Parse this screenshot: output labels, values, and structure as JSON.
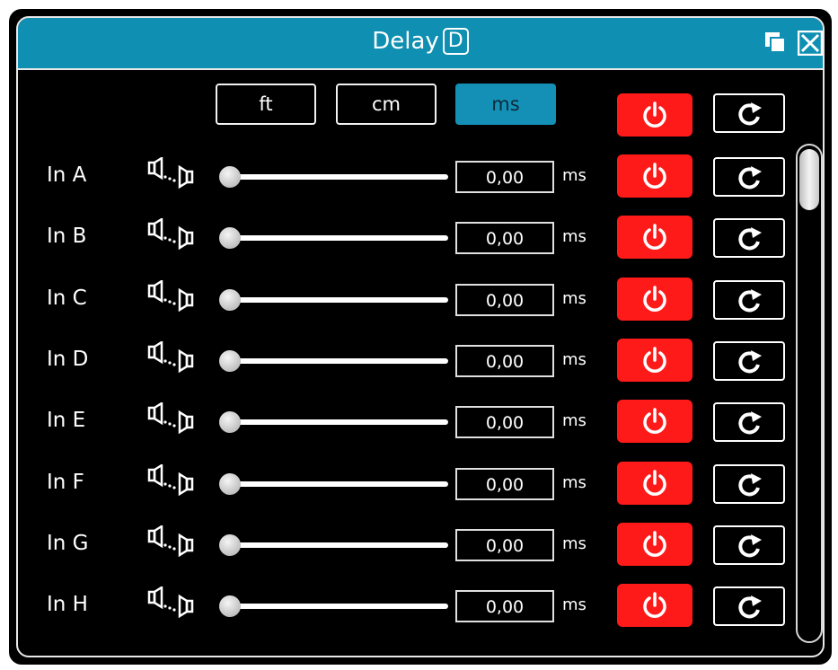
{
  "window": {
    "title": "Delay",
    "title_badge": "D",
    "titlebar_color": "#0f8fb1",
    "icons": [
      "restore-window-icon",
      "close-icon"
    ]
  },
  "units": [
    {
      "label": "ft",
      "active": false
    },
    {
      "label": "cm",
      "active": false
    },
    {
      "label": "ms",
      "active": true
    }
  ],
  "master": {
    "power_icon": "power-icon",
    "reset_icon": "reset-icon",
    "power_color": "#ff1a1a"
  },
  "channels": [
    {
      "label": "In A",
      "value": "0,00",
      "unit": "ms",
      "slider_level": 0
    },
    {
      "label": "In B",
      "value": "0,00",
      "unit": "ms",
      "slider_level": 0
    },
    {
      "label": "In C",
      "value": "0,00",
      "unit": "ms",
      "slider_level": 0
    },
    {
      "label": "In D",
      "value": "0,00",
      "unit": "ms",
      "slider_level": 0
    },
    {
      "label": "In E",
      "value": "0,00",
      "unit": "ms",
      "slider_level": 0
    },
    {
      "label": "In F",
      "value": "0,00",
      "unit": "ms",
      "slider_level": 0
    },
    {
      "label": "In G",
      "value": "0,00",
      "unit": "ms",
      "slider_level": 0
    },
    {
      "label": "In H",
      "value": "0,00",
      "unit": "ms",
      "slider_level": 0
    }
  ]
}
